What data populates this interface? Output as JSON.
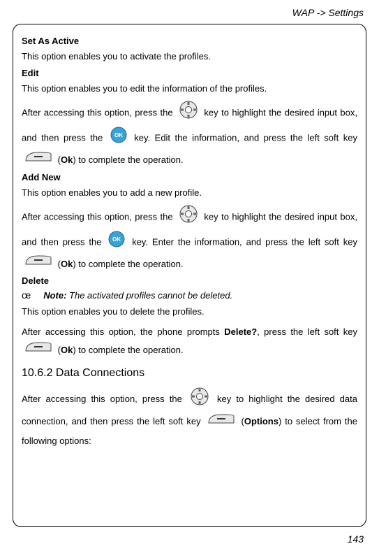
{
  "header": {
    "breadcrumb": "WAP -> Settings"
  },
  "sections": {
    "setAsActive": {
      "title": "Set As Active",
      "desc": "This option enables you to activate the profiles."
    },
    "edit": {
      "title": "Edit",
      "desc": "This option enables you to edit the information of the profiles.",
      "flow": {
        "p1": "After accessing this option, press the ",
        "p2": " key to highlight the desired input box, and then press the ",
        "p3": " key. Edit the information, and press the left soft key ",
        "p4": " (",
        "ok": "Ok",
        "p5": ") to complete the operation."
      }
    },
    "addNew": {
      "title": "Add New",
      "desc": "This option enables you to add a new profile.",
      "flow": {
        "p1": "After accessing this option, press the ",
        "p2": " key to highlight the desired input box, and then press the ",
        "p3": " key. Enter the information, and press the left soft key ",
        "p4": " (",
        "ok": "Ok",
        "p5": ") to complete the operation."
      }
    },
    "delete": {
      "title": "Delete",
      "noteIcon": "œ",
      "noteLabel": "Note:",
      "noteText": " The activated profiles cannot be deleted.",
      "desc": "This option enables you to delete the profiles.",
      "flow": {
        "p1": "After accessing this option, the phone prompts ",
        "bold": "Delete?",
        "p2": ", press the left soft key ",
        "p3": " (",
        "ok": "Ok",
        "p4": ") to complete the operation."
      }
    },
    "dataConn": {
      "title": "10.6.2 Data Connections",
      "flow": {
        "p1": "After accessing this option, press the ",
        "p2": " key to highlight the desired data connection, and then press the left soft key ",
        "p3": " (",
        "opt": "Options",
        "p4": ") to select from the following options:"
      }
    }
  },
  "pageNumber": "143"
}
